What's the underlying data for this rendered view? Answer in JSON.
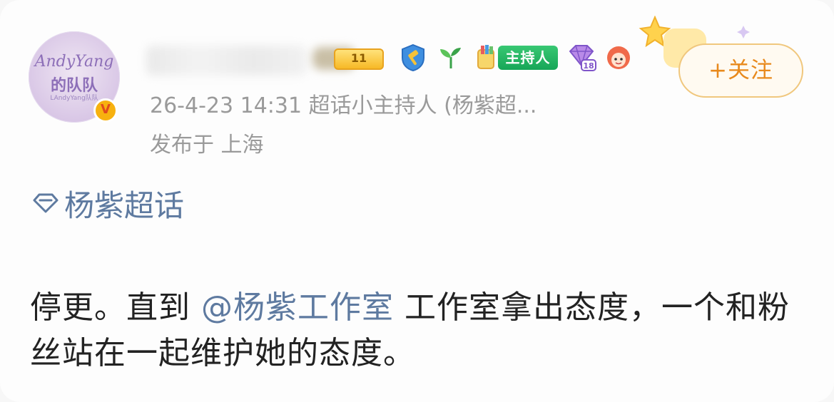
{
  "post": {
    "avatar": {
      "line1": "AndyYang",
      "line2": "的队队",
      "line3": "LAndyYang队队"
    },
    "verified_badge": "V",
    "level_badge": "11",
    "host_badge": "主持人",
    "follow_button": "+关注",
    "meta_line1": "26-4-23 14:31  超话小主持人 (杨紫超...",
    "meta_line2": "发布于 上海",
    "topic": "杨紫超话",
    "content_text_1": "停更。直到",
    "mention": "@杨紫工作室",
    "content_text_2": " 工作室拿出态度，一个和粉丝站在一起维护她的态度。"
  },
  "icons": {
    "topic": "diamond-topic-icon",
    "shield": "shield-hammer-icon",
    "sprout": "sprout-icon",
    "crayon": "crayon-icon",
    "gem": "gem-18-icon",
    "face": "avatar-face-icon"
  },
  "colors": {
    "follow": "#e8891c",
    "link": "#5e7aa0",
    "host_green": "#17a657",
    "meta_gray": "#9a9a9a"
  }
}
